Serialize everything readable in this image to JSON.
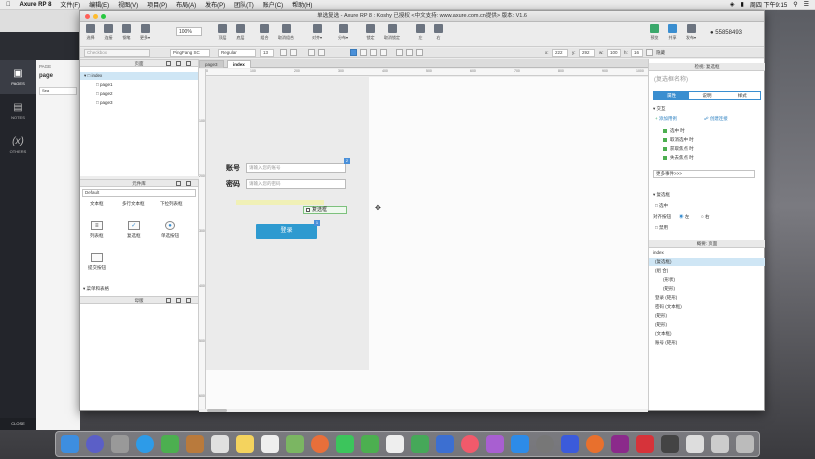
{
  "menubar": {
    "app_name": "Axure RP 8",
    "items": [
      "文件(F)",
      "编辑(E)",
      "视图(V)",
      "项目(P)",
      "布局(A)",
      "发布(P)",
      "团队(T)",
      "账户(C)",
      "帮助(H)"
    ],
    "clock": "周四 下午9:15"
  },
  "bg_app": {
    "sidebar": [
      "PAGES",
      "NOTES",
      "OTHERS"
    ],
    "close": "CLOSE",
    "pages_short": "PAGE",
    "page_item": "page",
    "search_short": "Sea"
  },
  "window": {
    "title": "单选复选 - Axure RP 8 : Koshy 已授权    <中文支持: www.axure.com.cn提供> 版本: V1.6"
  },
  "toolbar": {
    "buttons": [
      "选择",
      "连接",
      "钢笔",
      "更多▾",
      "顶层",
      "底层",
      "组合",
      "取消组合",
      "对齐▾",
      "分布▾",
      "锁定",
      "取消锁定",
      "左",
      "右",
      "预览",
      "共享",
      "发布▾"
    ],
    "zoom": "100%",
    "user": "55858493"
  },
  "format": {
    "style": "Checkbox",
    "font": "PingFang SC",
    "weight": "Regular",
    "size": "13",
    "x_label": "x:",
    "x_value": "222",
    "y_label": "y:",
    "y_value": "292",
    "w_label": "w:",
    "w_value": "100",
    "h_label": "h:",
    "h_value": "16",
    "hidden_label": "隐藏"
  },
  "pages_panel": {
    "title": "页面",
    "root": "index",
    "children": [
      "page1",
      "page2",
      "page3"
    ]
  },
  "library_panel": {
    "title": "元件库",
    "select": "Default",
    "items": [
      "文本框",
      "多行文本框",
      "下拉列表框",
      "列表框",
      "复选框",
      "单选按钮",
      "提交按钮"
    ],
    "group": "菜单和表格"
  },
  "masters_panel": {
    "title": "母版"
  },
  "tabs": [
    {
      "label": "page3",
      "active": false
    },
    {
      "label": "index",
      "active": true
    }
  ],
  "ruler_h": [
    "0",
    "100",
    "200",
    "300",
    "400",
    "500",
    "600",
    "700",
    "800",
    "900",
    "1000"
  ],
  "ruler_v": [
    "100",
    "200",
    "300",
    "400",
    "500",
    "600"
  ],
  "canvas": {
    "account_label": "账号",
    "account_placeholder": "请输入您的账号",
    "password_label": "密码",
    "password_placeholder": "请输入您的密码",
    "checkbox_label": "复选框",
    "login_button": "登录",
    "marker_a": "2",
    "marker_b": "1"
  },
  "inspector": {
    "title": "检视: 复选框",
    "name_placeholder": "(复选框名称)",
    "tabs": [
      "属性",
      "说明",
      "样式"
    ],
    "interaction": "交互",
    "add_case": "添加用例",
    "create_link": "创建连接",
    "events": [
      "选中 时",
      "取消选中 时",
      "获取焦点 时",
      "失去焦点 时"
    ],
    "more_events": "更多事件>>>",
    "checkbox_section": "复选框",
    "selected": "选中",
    "align_label": "对齐按钮",
    "align_left": "左",
    "align_right": "右",
    "disabled": "禁用"
  },
  "outline": {
    "title": "概要: 页面",
    "root": "index",
    "items": [
      "(复选框)",
      "(组 合)",
      "(形状)",
      "(矩形)",
      "登录 (矩形)",
      "密码 (文本框)",
      "(矩形)",
      "(矩形)",
      "(文本框)",
      "账号 (矩形)"
    ]
  }
}
